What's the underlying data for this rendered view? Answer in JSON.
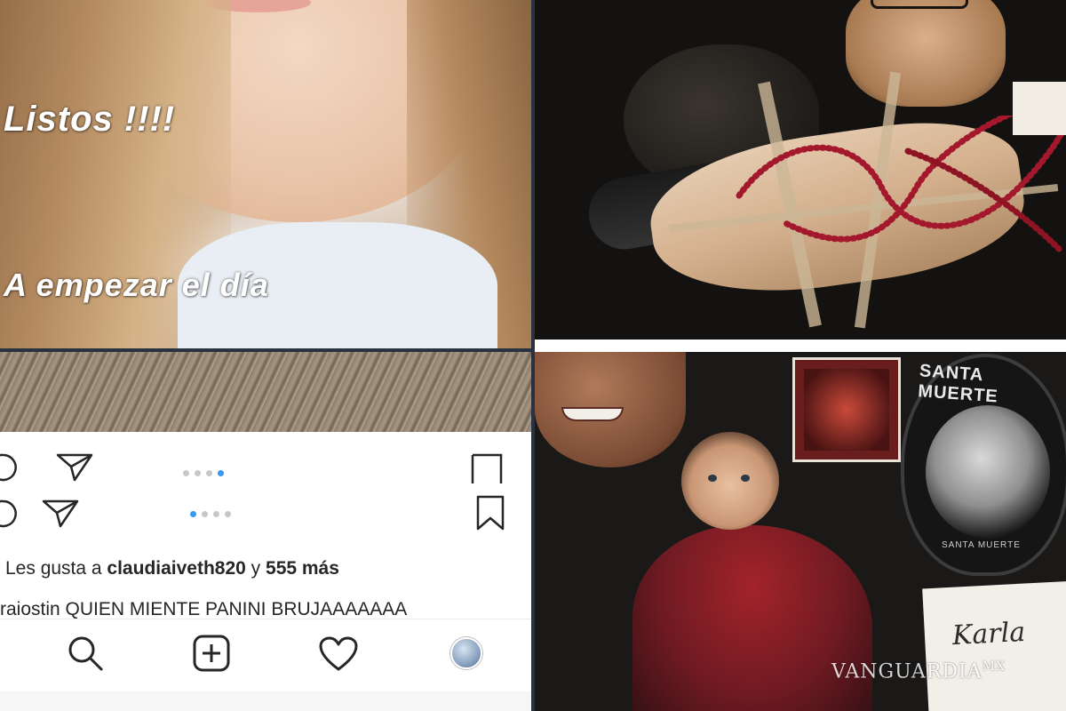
{
  "story": {
    "line1": "Listos !!!!",
    "line2": "A empezar el día"
  },
  "instagram": {
    "likes_prefix": "Les gusta a ",
    "likes_user": "claudiaiveth820",
    "likes_mid": " y ",
    "likes_count": "555 más",
    "caption_user": "raiostin",
    "caption_text": " QUIEN MIENTE PANINI BRUJAAAAAAA",
    "carousel_top": {
      "count": 4,
      "active_index": 3
    },
    "carousel_bottom": {
      "count": 4,
      "active_index": 0
    },
    "nav_icons": [
      "search-icon",
      "add-post-icon",
      "heart-icon",
      "profile-avatar"
    ],
    "accent_color": "#3897f0"
  },
  "altar": {
    "badge_title": "SANTA MUERTE",
    "badge_sub": "SANTA MUERTE",
    "card_text": "Karla"
  },
  "watermark": {
    "brand": "VANGUARDIA",
    "suffix": "MX"
  }
}
